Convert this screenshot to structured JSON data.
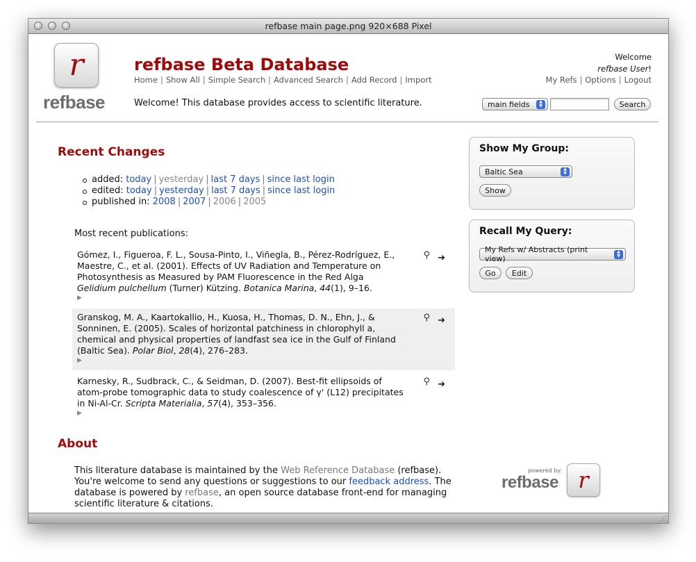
{
  "window": {
    "title": "refbase main page.png 920×688 Pixel"
  },
  "header": {
    "logo_letter": "r",
    "logo_text": "refbase",
    "site_title": "refbase Beta Database",
    "nav": [
      "Home",
      "Show All",
      "Simple Search",
      "Advanced Search",
      "Add Record",
      "Import"
    ],
    "welcome_message": "Welcome! This database provides access to scientific literature.",
    "user": {
      "greeting": "Welcome",
      "name": "refbase User",
      "suffix": "!",
      "links": [
        "My Refs",
        "Options",
        "Logout"
      ]
    },
    "search": {
      "field_select": "main fields",
      "query": "",
      "button": "Search"
    }
  },
  "recent_changes": {
    "heading": "Recent Changes",
    "added": {
      "label": "added:",
      "today": "today",
      "yesterday": "yesterday",
      "last7": "last 7 days",
      "since": "since last login"
    },
    "edited": {
      "label": "edited:",
      "today": "today",
      "yesterday": "yesterday",
      "last7": "last 7 days",
      "since": "since last login"
    },
    "published": {
      "label": "published in:",
      "years": [
        "2008",
        "2007",
        "2006",
        "2005"
      ]
    }
  },
  "publications": {
    "label": "Most recent publications:",
    "items": [
      {
        "authors": "Gómez, I., Figueroa, F. L., Sousa-Pinto, I., Viñegla, B., Pérez-Rodríguez, E., Maestre, C., et al. (2001). Effects of UV Radiation and Temperature on Photosynthesis as Measured by PAM Fluorescence in the Red Alga ",
        "italic1": "Gelidium pulchellum",
        "middle": " (Turner) Kützing. ",
        "journal": "Botanica Marina",
        "sep": ", ",
        "volume": "44",
        "tail": "(1), 9–16."
      },
      {
        "authors": "Granskog, M. A., Kaartokallio, H., Kuosa, H., Thomas, D. N., Ehn, J., & Sonninen, E. (2005). Scales of horizontal patchiness in chlorophyll a, chemical and physical properties of landfast sea ice in the Gulf of Finland (Baltic Sea). ",
        "journal": "Polar Biol",
        "sep": ", ",
        "volume": "28",
        "tail": "(4), 276–283."
      },
      {
        "authors": "Karnesky, R., Sudbrack, C., & Seidman, D. (2007). Best-fit ellipsoids of atom-probe tomographic data to study coalescence of γ' (L12) precipitates in Ni-Al-Cr. ",
        "journal": "Scripta Materialia",
        "sep": ", ",
        "volume": "57",
        "tail": "(4), 353–356."
      }
    ]
  },
  "about": {
    "heading": "About",
    "t1": "This literature database is maintained by the ",
    "link1": "Web Reference Database",
    "t2": " (refbase). You're welcome to send any questions or suggestions to our ",
    "link2": "feedback address",
    "t3": ". The database is powered by ",
    "link3": "refbase",
    "t4": ", an open source database front-end for managing scientific literature & citations."
  },
  "sidebar": {
    "group": {
      "heading": "Show My Group:",
      "selected": "Baltic Sea",
      "button": "Show"
    },
    "query": {
      "heading": "Recall My Query:",
      "selected": "My Refs w/ Abstracts (print view)",
      "go": "Go",
      "edit": "Edit"
    }
  },
  "powered_by": {
    "small": "powered by:",
    "text": "refbase",
    "letter": "r"
  }
}
